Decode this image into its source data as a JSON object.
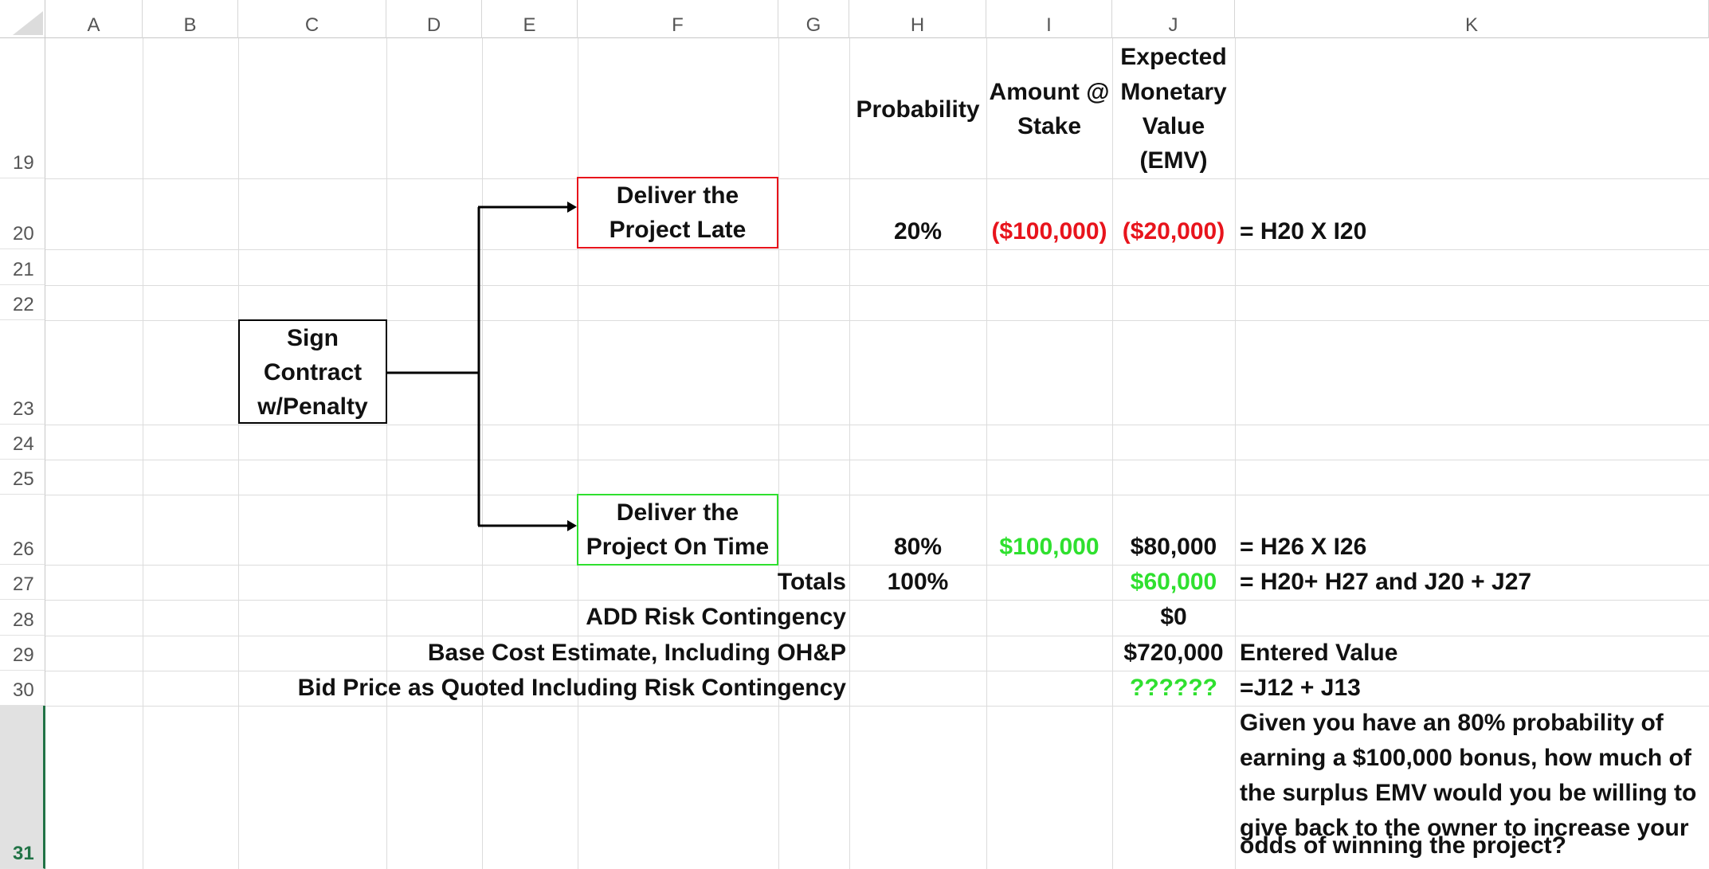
{
  "columns": [
    "A",
    "B",
    "C",
    "D",
    "E",
    "F",
    "G",
    "H",
    "I",
    "J",
    "K"
  ],
  "rows": [
    "19",
    "20",
    "21",
    "22",
    "23",
    "24",
    "25",
    "26",
    "27",
    "28",
    "29",
    "30",
    "31"
  ],
  "headers": {
    "probability": "Probability",
    "amount_line1": "Amount @",
    "amount_line2": "Stake",
    "emv_line1": "Expected",
    "emv_line2": "Monetary",
    "emv_line3": "Value",
    "emv_line4": "(EMV)"
  },
  "boxes": {
    "late_line1": "Deliver the",
    "late_line2": "Project Late",
    "ontime_line1": "Deliver the",
    "ontime_line2": "Project On Time",
    "sign_line1": "Sign",
    "sign_line2": "Contract",
    "sign_line3": "w/Penalty"
  },
  "row20": {
    "probability": "20%",
    "amount": "($100,000)",
    "emv": "($20,000)",
    "formula": "= H20 X I20"
  },
  "row26": {
    "probability": "80%",
    "amount": "$100,000",
    "emv": "$80,000",
    "formula": "= H26 X I26"
  },
  "row27": {
    "label": "Totals",
    "probability": "100%",
    "emv": "$60,000",
    "formula": "= H20+ H27 and J20 + J27"
  },
  "row28": {
    "label": "ADD Risk Contingency",
    "emv": "$0"
  },
  "row29": {
    "label": "Base Cost Estimate, Including OH&P",
    "emv": "$720,000",
    "note": "Entered Value"
  },
  "row30": {
    "label": "Bid Price as Quoted Including Risk Contingency",
    "emv": "??????",
    "formula": "=J12 + J13"
  },
  "row31": {
    "line1": "Given you have an 80% probability of",
    "line2": "earning a $100,000 bonus, how much of",
    "line3": "the surplus EMV would you be willing to",
    "line4": "give back to the owner to increase your",
    "line5": "odds of winning the project?"
  },
  "colors": {
    "red": "#e8141c",
    "green": "#2fe02f",
    "excel_green": "#217346"
  }
}
